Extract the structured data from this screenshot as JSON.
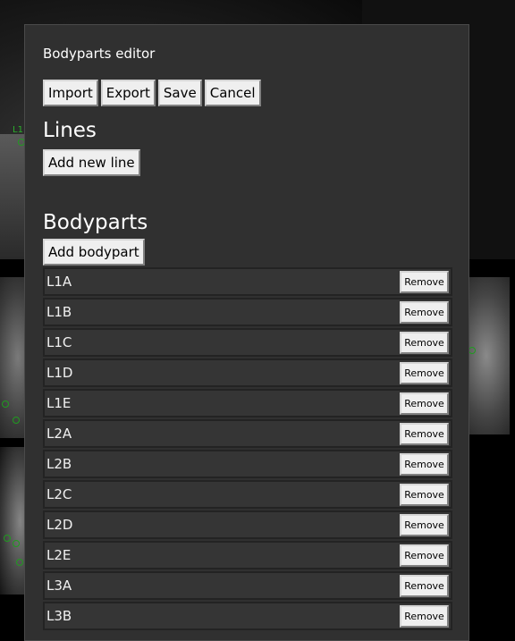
{
  "panel": {
    "title": "Bodyparts editor",
    "toolbar": {
      "import_label": "Import",
      "export_label": "Export",
      "save_label": "Save",
      "cancel_label": "Cancel"
    },
    "lines": {
      "heading": "Lines",
      "add_label": "Add new line"
    },
    "bodyparts": {
      "heading": "Bodyparts",
      "add_label": "Add bodypart",
      "remove_label": "Remove",
      "items": [
        "L1A",
        "L1B",
        "L1C",
        "L1D",
        "L1E",
        "L2A",
        "L2B",
        "L2C",
        "L2D",
        "L2E",
        "L3A",
        "L3B"
      ]
    }
  },
  "background": {
    "marker_label": "L1",
    "marker_color": "#1f9b1f"
  }
}
